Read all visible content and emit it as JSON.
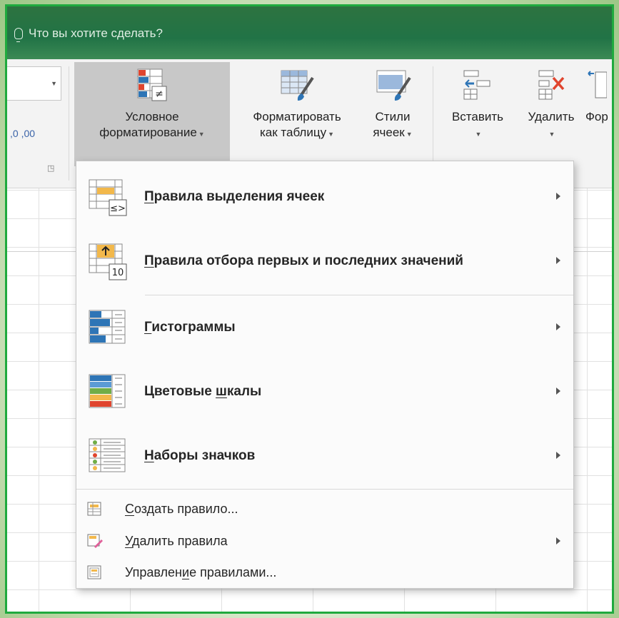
{
  "tellme": {
    "placeholder_text": "Что вы хотите сделать?"
  },
  "ribbon": {
    "conditional_formatting": {
      "line1": "Условное",
      "line2": "форматирование"
    },
    "format_as_table": {
      "line1": "Форматировать",
      "line2": "как таблицу"
    },
    "cell_styles": {
      "line1": "Стили",
      "line2": "ячеек"
    },
    "insert": {
      "label": "Вставить"
    },
    "delete": {
      "label": "Удалить"
    },
    "format": {
      "label": "Фор"
    },
    "number_format_glyphs": ",0 ,00"
  },
  "menu": {
    "big_items": [
      {
        "pre": "",
        "u": "П",
        "post": "равила выделения ячеек",
        "icon": "highlight-cells-rules-icon",
        "has_submenu": true
      },
      {
        "pre": "",
        "u": "П",
        "post": "равила отбора первых и последних значений",
        "icon": "top-bottom-rules-icon",
        "has_submenu": true
      },
      {
        "pre": "",
        "u": "Г",
        "post": "истограммы",
        "icon": "data-bars-icon",
        "has_submenu": true
      },
      {
        "pre": "Цветовые ",
        "u": "ш",
        "post": "калы",
        "icon": "color-scales-icon",
        "has_submenu": true
      },
      {
        "pre": "",
        "u": "Н",
        "post": "аборы значков",
        "icon": "icon-sets-icon",
        "has_submenu": true
      }
    ],
    "small_items": [
      {
        "pre": "",
        "u": "С",
        "post": "оздать правило...",
        "icon": "new-rule-icon",
        "has_submenu": false
      },
      {
        "pre": "",
        "u": "У",
        "post": "далить правила",
        "icon": "clear-rules-icon",
        "has_submenu": true
      },
      {
        "pre": "Управлен",
        "u": "и",
        "post": "е правилами...",
        "icon": "manage-rules-icon",
        "has_submenu": false
      }
    ],
    "top_bottom_badge": "10"
  },
  "colors": {
    "accent_green": "#217346",
    "frame_green": "#1faa3e",
    "bar_blue": "#2e75b6"
  }
}
